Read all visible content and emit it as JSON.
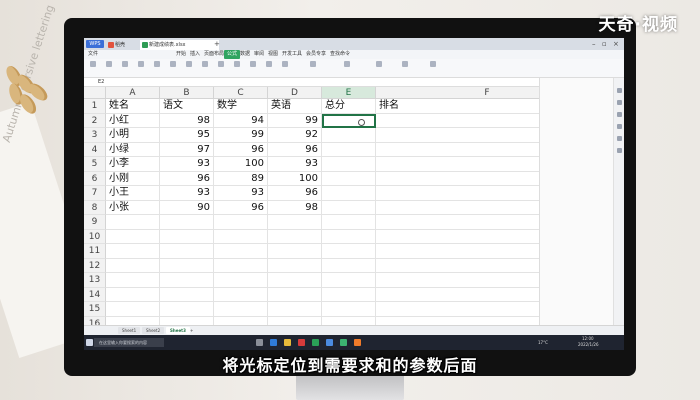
{
  "watermark": "天奇·视频",
  "subtitle": "将光标定位到需要求和的参数后面",
  "window": {
    "app_button": "WPS",
    "tabs": [
      "稻壳",
      "新建成绩表.xlsx"
    ],
    "active_tab_index": 1
  },
  "menu": {
    "items": [
      "文件",
      "开始",
      "插入",
      "页面布局",
      "公式",
      "数据",
      "审阅",
      "视图",
      "开发工具",
      "会员专享",
      "查找命令"
    ],
    "active_index": 4
  },
  "formula_bar": {
    "name_box": "E2"
  },
  "sheet": {
    "columns": [
      "A",
      "B",
      "C",
      "D",
      "E",
      "F"
    ],
    "selected_column": "E",
    "selected_cell": "E2",
    "row_numbers": [
      "1",
      "2",
      "3",
      "4",
      "5",
      "6",
      "7",
      "8",
      "9",
      "10",
      "11",
      "12",
      "13",
      "14",
      "15",
      "16"
    ],
    "rows": [
      [
        "姓名",
        "语文",
        "数学",
        "英语",
        "总分",
        "排名"
      ],
      [
        "小红",
        "98",
        "94",
        "99",
        "",
        ""
      ],
      [
        "小明",
        "95",
        "99",
        "92",
        "",
        ""
      ],
      [
        "小绿",
        "97",
        "96",
        "96",
        "",
        ""
      ],
      [
        "小李",
        "93",
        "100",
        "93",
        "",
        ""
      ],
      [
        "小刚",
        "96",
        "89",
        "100",
        "",
        ""
      ],
      [
        "小王",
        "93",
        "93",
        "96",
        "",
        ""
      ],
      [
        "小张",
        "90",
        "96",
        "98",
        "",
        ""
      ]
    ],
    "tabs": [
      "Sheet1",
      "Sheet2",
      "Sheet3"
    ],
    "active_sheet_index": 2
  },
  "taskbar": {
    "search_placeholder": "在这里输入你要搜索的内容",
    "weather": "17°C",
    "time": "12:00",
    "date": "2022/1/26"
  },
  "colors": {
    "accent": "#217346",
    "menu_active": "#30a460",
    "monitor_bezel": "#111111",
    "taskbar": "#1f2430"
  }
}
